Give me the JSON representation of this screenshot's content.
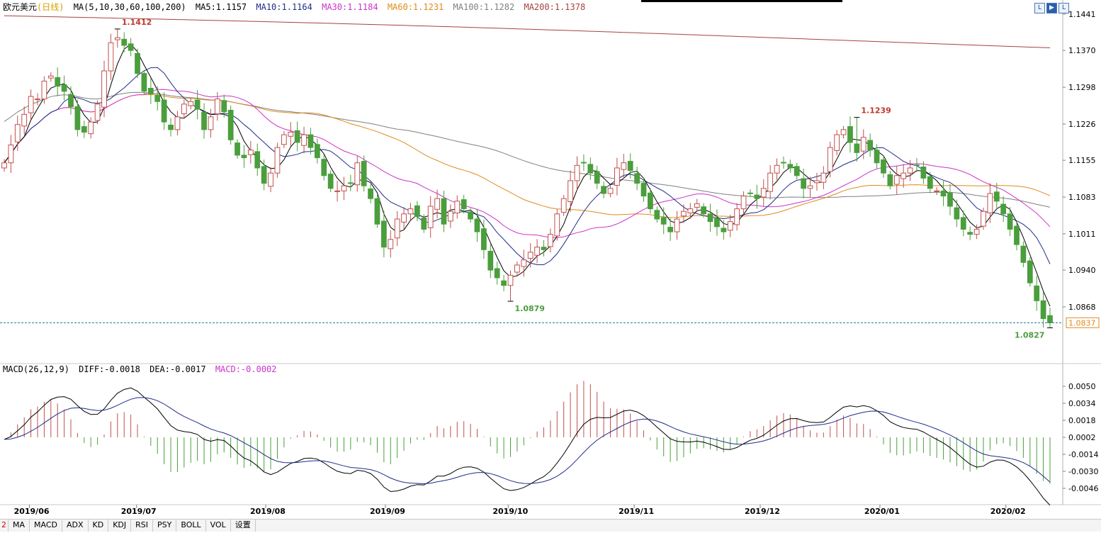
{
  "legend": {
    "title": "欧元美元",
    "period": "(日线)",
    "ma_label": "MA(5,10,30,60,100,200)",
    "ma5": "MA5:1.1157",
    "ma10": "MA10:1.1164",
    "ma30": "MA30:1.1184",
    "ma60": "MA60:1.1231",
    "ma100": "MA100:1.1282",
    "ma200": "MA200:1.1378"
  },
  "macd_legend": {
    "label": "MACD(26,12,9)",
    "diff": "DIFF:-0.0018",
    "dea": "DEA:-0.0017",
    "macd": "MACD:-0.0002"
  },
  "colors": {
    "up": "#c0504d",
    "down": "#4a9e3c",
    "ma5": "#000000",
    "ma10": "#1f2d8a",
    "ma30": "#cc33cc",
    "ma60": "#e08a1e",
    "ma100": "#808080",
    "ma200": "#a5433f",
    "price_line": "#1a7a9a"
  },
  "current_price": "1.0837",
  "tabs": [
    "2",
    "MA",
    "MACD",
    "ADX",
    "KD",
    "KDJ",
    "RSI",
    "PSY",
    "BOLL",
    "VOL",
    "设置"
  ],
  "top_buttons": [
    "L",
    "▶",
    "L"
  ],
  "chart_data": [
    {
      "type": "candlestick",
      "title": "欧元美元",
      "ylim": [
        1.08,
        1.1441
      ],
      "y_ticks": [
        "1.1441",
        "1.1370",
        "1.1298",
        "1.1226",
        "1.1155",
        "1.1083",
        "1.1011",
        "1.0940",
        "1.0868"
      ],
      "x_labels": [
        "2019/06",
        "2019/07",
        "2019/08",
        "2019/09",
        "2019/10",
        "2019/11",
        "2019/12",
        "2020/01",
        "2020/02"
      ],
      "annotations": [
        {
          "label": "1.1412",
          "kind": "high"
        },
        {
          "label": "1.1239",
          "kind": "high"
        },
        {
          "label": "1.0879",
          "kind": "low"
        },
        {
          "label": "1.0827",
          "kind": "low"
        }
      ],
      "closes": [
        1.115,
        1.1185,
        1.1225,
        1.1245,
        1.128,
        1.1275,
        1.131,
        1.132,
        1.13,
        1.129,
        1.126,
        1.1215,
        1.121,
        1.123,
        1.1265,
        1.133,
        1.1385,
        1.1395,
        1.138,
        1.137,
        1.1325,
        1.129,
        1.1285,
        1.127,
        1.123,
        1.1215,
        1.124,
        1.1265,
        1.127,
        1.1255,
        1.1215,
        1.124,
        1.1275,
        1.125,
        1.1195,
        1.1165,
        1.116,
        1.1175,
        1.114,
        1.111,
        1.113,
        1.118,
        1.1205,
        1.121,
        1.119,
        1.1205,
        1.118,
        1.116,
        1.1125,
        1.11,
        1.1095,
        1.1105,
        1.111,
        1.115,
        1.1105,
        1.108,
        1.103,
        1.0985,
        1.1,
        1.104,
        1.105,
        1.106,
        1.1045,
        1.102,
        1.1065,
        1.108,
        1.103,
        1.1055,
        1.1075,
        1.106,
        1.104,
        1.1015,
        1.098,
        1.094,
        1.0925,
        1.091,
        1.093,
        1.095,
        1.096,
        1.0975,
        1.0985,
        1.098,
        1.101,
        1.105,
        1.108,
        1.1115,
        1.1145,
        1.115,
        1.113,
        1.111,
        1.109,
        1.11,
        1.114,
        1.115,
        1.1135,
        1.111,
        1.1085,
        1.106,
        1.104,
        1.103,
        1.1015,
        1.104,
        1.1055,
        1.106,
        1.107,
        1.105,
        1.1035,
        1.1025,
        1.1015,
        1.1035,
        1.106,
        1.1085,
        1.109,
        1.108,
        1.11,
        1.113,
        1.1145,
        1.115,
        1.114,
        1.1125,
        1.11,
        1.1105,
        1.1115,
        1.113,
        1.118,
        1.1205,
        1.1215,
        1.119,
        1.117,
        1.12,
        1.1175,
        1.115,
        1.113,
        1.1105,
        1.1125,
        1.113,
        1.114,
        1.1145,
        1.112,
        1.11,
        1.1095,
        1.1085,
        1.1065,
        1.104,
        1.102,
        1.101,
        1.102,
        1.1055,
        1.109,
        1.1075,
        1.105,
        1.102,
        1.099,
        1.0955,
        1.0915,
        1.088,
        1.0845,
        1.0837
      ]
    },
    {
      "type": "macd",
      "title": "MACD(26,12,9)",
      "ylim": [
        -0.006,
        0.006
      ],
      "y_ticks": [
        "0.0050",
        "0.0034",
        "0.0018",
        "0.0002",
        "-0.0014",
        "-0.0030",
        "-0.0046"
      ]
    }
  ]
}
